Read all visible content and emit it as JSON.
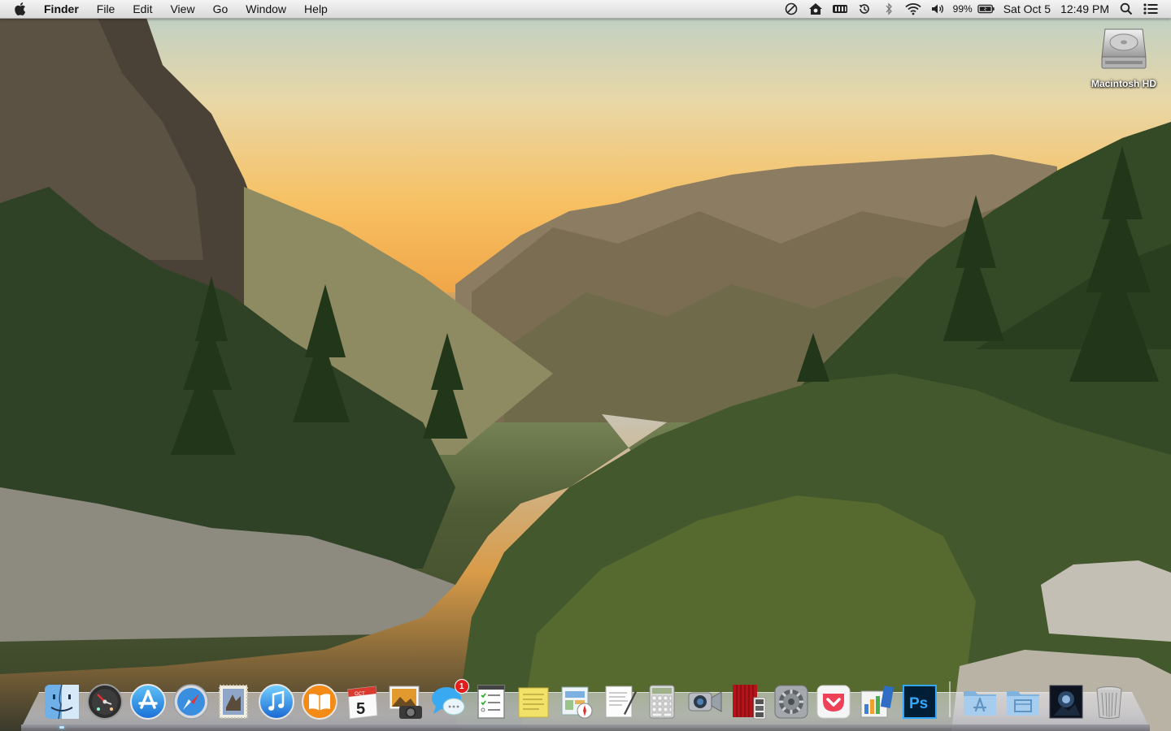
{
  "menubar": {
    "app_name": "Finder",
    "menus": [
      "File",
      "Edit",
      "View",
      "Go",
      "Window",
      "Help"
    ],
    "status": {
      "battery_percent": "99%",
      "date": "Sat Oct 5",
      "time": "12:49 PM"
    }
  },
  "desktop": {
    "volume_label": "Macintosh HD"
  },
  "dock": {
    "calendar": {
      "month": "OCT",
      "day": "5"
    },
    "messages_badge": "1",
    "photoshop_label": "Ps"
  },
  "colors": {
    "menubar_bg": "#e6e6e6",
    "badge_red": "#e01e1e",
    "photoshop_blue": "#31a8ff"
  }
}
